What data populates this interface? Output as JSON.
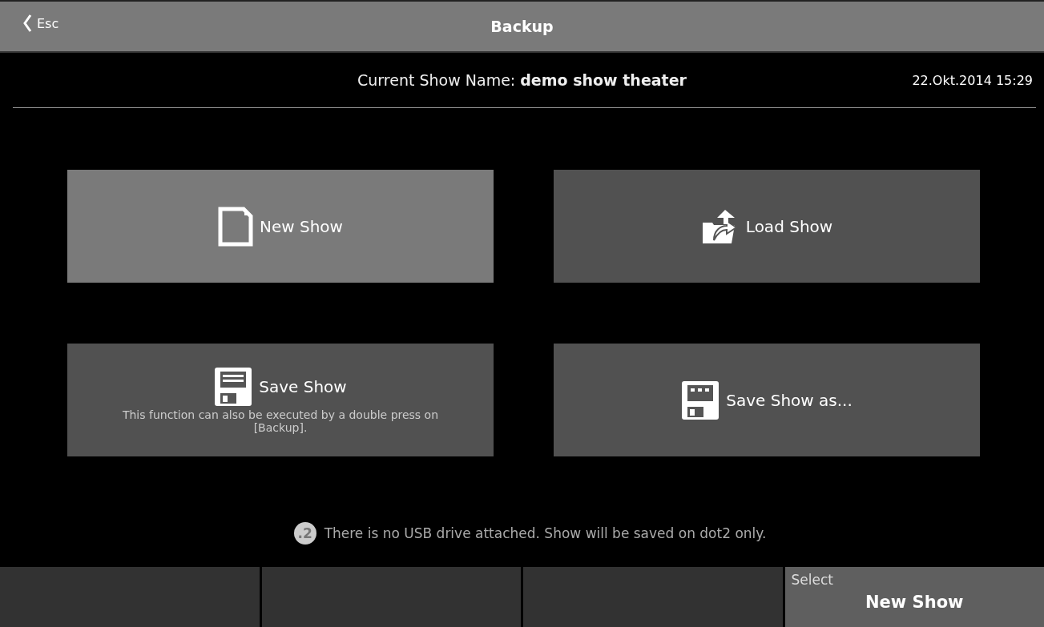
{
  "title_bar": {
    "back_label": "Esc",
    "title": "Backup"
  },
  "info": {
    "show_name_label": "Current Show Name:",
    "show_name": "demo show theater",
    "datetime": "22.Okt.2014 15:29"
  },
  "tiles": [
    {
      "kind": "new",
      "label": "New Show",
      "selected": true
    },
    {
      "kind": "load",
      "label": "Load Show",
      "selected": false
    },
    {
      "kind": "save",
      "label": "Save Show",
      "description": "This function can also be executed by a double press on [Backup].",
      "selected": false
    },
    {
      "kind": "save_as",
      "label": "Save Show as...",
      "selected": false
    }
  ],
  "notice": {
    "logo_text": ".2",
    "message": "There is no USB drive attached. Show will be saved on dot2 only."
  },
  "softkeys": [
    {
      "kind": "empty"
    },
    {
      "kind": "empty"
    },
    {
      "kind": "empty"
    },
    {
      "kind": "select",
      "caption": "Select",
      "value": "New Show"
    }
  ]
}
